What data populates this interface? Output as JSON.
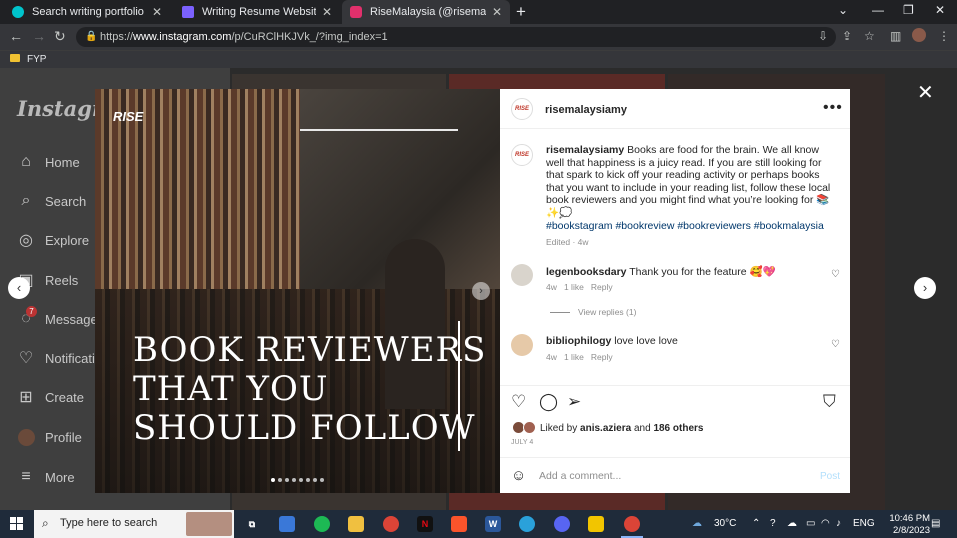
{
  "browser": {
    "tabs": [
      {
        "title": "Search writing portfolio - Canva",
        "active": false,
        "color": "#00c4cc"
      },
      {
        "title": "Writing Resume Website in Paste",
        "active": false,
        "color": "#7b61ff"
      },
      {
        "title": "RiseMalaysia (@risemalaysiamy)",
        "active": true,
        "color": "#e1306c"
      }
    ],
    "url_prefix": "https://",
    "url_host": "www.instagram.com",
    "url_path": "/p/CuRClHKJVk_/?img_index=1",
    "bookmark": "FYP"
  },
  "sidebar": {
    "logo": "Instagram",
    "items": [
      {
        "label": "Home",
        "icon": "home-icon"
      },
      {
        "label": "Search",
        "icon": "search-icon"
      },
      {
        "label": "Explore",
        "icon": "explore-icon"
      },
      {
        "label": "Reels",
        "icon": "reels-icon"
      },
      {
        "label": "Messages",
        "icon": "messages-icon",
        "badge": "7"
      },
      {
        "label": "Notifications",
        "icon": "heart-icon"
      },
      {
        "label": "Create",
        "icon": "create-icon"
      },
      {
        "label": "Profile",
        "icon": "avatar"
      },
      {
        "label": "More",
        "icon": "menu-icon"
      }
    ]
  },
  "post": {
    "image_brand": "RISE",
    "headline": [
      "BOOK REVIEWERS",
      "THAT YOU",
      "SHOULD FOLLOW"
    ],
    "carousel_count": 8,
    "carousel_index": 1,
    "username": "risemalaysiamy",
    "caption": "Books are food for the brain. We all know well that happiness is a juicy read. If you are still looking for that spark to kick off your reading activity or perhaps books that you want to include in your reading list, follow these local book reviewers and you might find what you’re looking for 📚✨💭",
    "hashtags": "#bookstagram #bookreview #bookreviewers #bookmalaysia",
    "caption_meta": "Edited · 4w",
    "comments": [
      {
        "user": "legenbooksdary",
        "text": "Thank you for the feature 🥰💖",
        "age": "4w",
        "likes": "1 like",
        "reply": "Reply"
      },
      {
        "user": "bibliophilogy",
        "text": "love love love",
        "age": "4w",
        "likes": "1 like",
        "reply": "Reply"
      }
    ],
    "view_replies": "View replies (1)",
    "liked_by_prefix": "Liked by",
    "liked_by_user": "anis.aziera",
    "liked_by_and": "and",
    "liked_by_others": "186 others",
    "date": "JULY 4",
    "comment_placeholder": "Add a comment...",
    "post_button": "Post"
  },
  "taskbar": {
    "search_placeholder": "Type here to search",
    "weather": "30°C",
    "lang": "ENG",
    "time": "10:46 PM",
    "date": "2/8/2023"
  }
}
